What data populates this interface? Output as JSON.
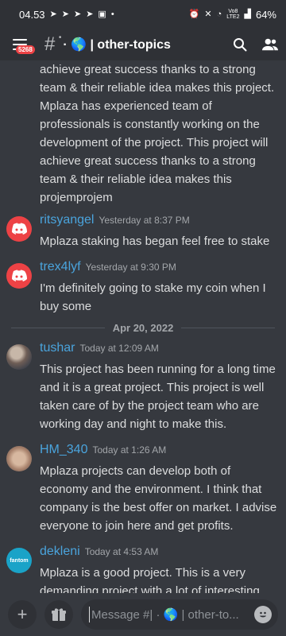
{
  "status_bar": {
    "time": "04.53",
    "battery": "64%",
    "net_top": "Vo8",
    "net_bottom": "LTE2"
  },
  "header": {
    "badge_count": "5268",
    "channel_title": "· 🌎 | other-topics"
  },
  "chat": {
    "continuation_text": "achieve great success thanks to a strong team & their reliable idea makes this project. Mplaza has  experienced team of professionals is constantly working on the development of the project. This project will achieve great success thanks to a strong team & their reliable idea makes this projemprojem",
    "date_divider": "Apr 20, 2022",
    "messages": [
      {
        "author": "ritsyangel",
        "time": "Yesterday at 8:37 PM",
        "text": "Mplaza staking has began feel free to stake",
        "avatar": "discord-default"
      },
      {
        "author": "trex4lyf",
        "time": "Yesterday at 9:30 PM",
        "text": "I'm definitely going to stake my coin when I buy some",
        "avatar": "discord-default"
      },
      {
        "author": "tushar",
        "time": "Today at 12:09 AM",
        "text": "This project has been running for a long time and it is a great project. This project is well taken care of by the project team who are working day and night to make this.",
        "avatar": "photo"
      },
      {
        "author": "HM_340",
        "time": "Today at 1:26 AM",
        "text": "Mplaza projects can develop both of economy and the environment. I think that company is the best offer on market. I advise everyone to join here and get profits.",
        "avatar": "photo"
      },
      {
        "author": "dekleni",
        "time": "Today at 4:53 AM",
        "text": "Mplaza  is a good project. This is a very demanding project with a lot of interesting things. I hope this project will be successful.",
        "avatar": "fantom",
        "avatar_text": "fantom"
      }
    ]
  },
  "composer": {
    "placeholder": "Message #| · 🌎 | other-to..."
  },
  "colors": {
    "background": "#36393f",
    "header_bg": "#2f3136",
    "author": "#4aa4dd",
    "badge": "#ed4245"
  }
}
